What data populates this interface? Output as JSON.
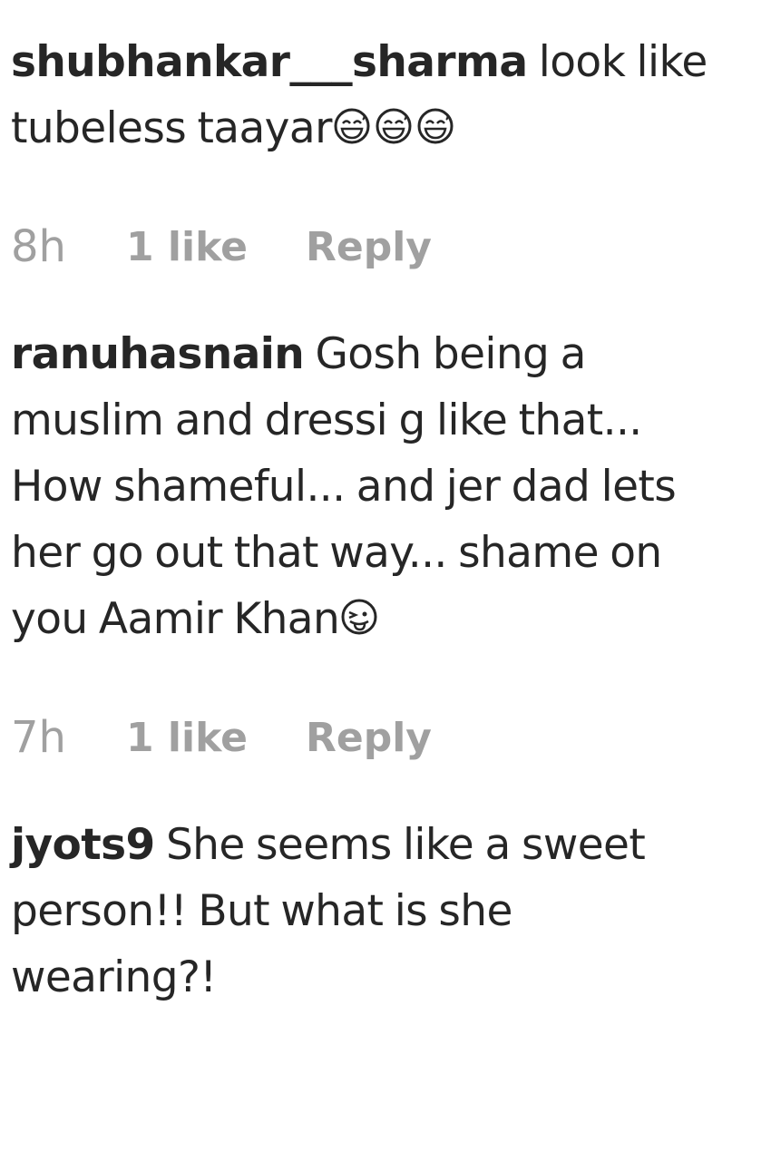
{
  "comments": [
    {
      "username": "shubhankar___sharma",
      "text_lines": [
        "look like",
        "tubeless taayar"
      ],
      "emoji": [
        "grinning-sweat-face",
        "grinning-sweat-face",
        "grinning-sweat-face"
      ],
      "time": "8h",
      "likes": "1 like",
      "reply_label": "Reply"
    },
    {
      "username": "ranuhasnain",
      "text_lines": [
        "Gosh being a",
        "muslim and dressi g like that...",
        "How shameful... and jer dad lets",
        "her go out that way... shame on",
        "you Aamir Khan"
      ],
      "emoji": [
        "winking-tongue-face"
      ],
      "time": "7h",
      "likes": "1 like",
      "reply_label": "Reply"
    },
    {
      "username": "jyots9",
      "text_lines": [
        "She seems like a sweet",
        "person!! But what is she",
        "wearing?!"
      ]
    }
  ]
}
